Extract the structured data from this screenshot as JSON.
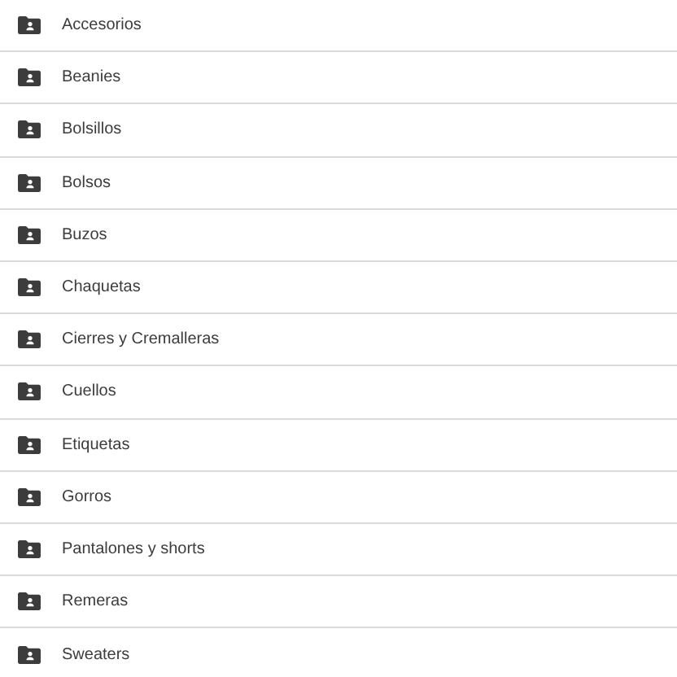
{
  "folders": [
    {
      "name": "Accesorios"
    },
    {
      "name": "Beanies"
    },
    {
      "name": "Bolsillos"
    },
    {
      "name": "Bolsos"
    },
    {
      "name": "Buzos"
    },
    {
      "name": "Chaquetas"
    },
    {
      "name": "Cierres y Cremalleras"
    },
    {
      "name": "Cuellos"
    },
    {
      "name": "Etiquetas"
    },
    {
      "name": "Gorros"
    },
    {
      "name": "Pantalones y shorts"
    },
    {
      "name": "Remeras"
    },
    {
      "name": "Sweaters"
    }
  ]
}
